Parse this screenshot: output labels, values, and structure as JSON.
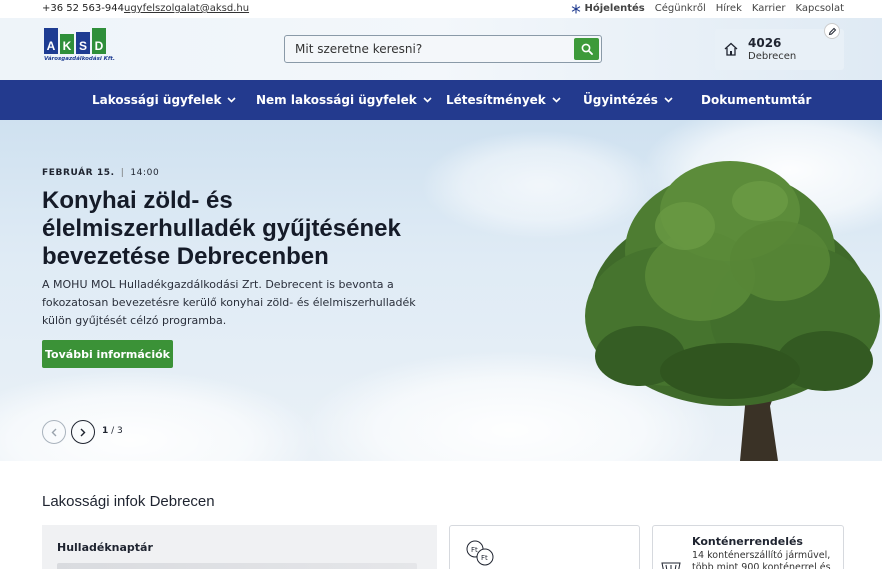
{
  "topbar": {
    "phone": "+36 52 563-944",
    "email": "ugyfelszolgalat@aksd.hu",
    "links": [
      "Hójelentés",
      "Cégünkről",
      "Hírek",
      "Karrier",
      "Kapcsolat"
    ]
  },
  "logo": {
    "letters": [
      "A",
      "K",
      "S",
      "D"
    ],
    "subtitle": "Városgazdálkodási Kft."
  },
  "search": {
    "placeholder": "Mit szeretne keresni?"
  },
  "location": {
    "zip": "4026",
    "city": "Debrecen"
  },
  "nav": {
    "items": [
      {
        "label": "Lakossági ügyfelek",
        "dropdown": true
      },
      {
        "label": "Nem lakossági ügyfelek",
        "dropdown": true
      },
      {
        "label": "Létesítmények",
        "dropdown": true
      },
      {
        "label": "Ügyintézés",
        "dropdown": true
      },
      {
        "label": "Dokumentumtár",
        "dropdown": false
      }
    ]
  },
  "hero": {
    "date": "FEBRUÁR 15.",
    "time": "14:00",
    "title": "Konyhai zöld- és élelmiszerhulladék gyűjtésének bevezetése Debrecenben",
    "lead": "A MOHU MOL Hulladékgazdálkodási Zrt. Debrecent is bevonta a fokozatosan bevezetésre kerülő konyhai zöld- és élelmiszerhulladék külön gyűjtését célzó programba.",
    "cta": "További információk",
    "pager_current": "1",
    "pager_total": "/ 3"
  },
  "info": {
    "title": "Lakossági infok Debrecen",
    "cards": [
      {
        "title": "Hulladéknaptár"
      },
      {
        "title": "",
        "icon": "coins-icon"
      },
      {
        "title": "Konténerrendelés",
        "desc": "14 konténerszállító járművel, több mint 900 konténerrel és"
      }
    ]
  },
  "colors": {
    "nav_bg": "#233a8e",
    "accent_green": "#3b9237",
    "brand_blue": "#1e3c92"
  }
}
